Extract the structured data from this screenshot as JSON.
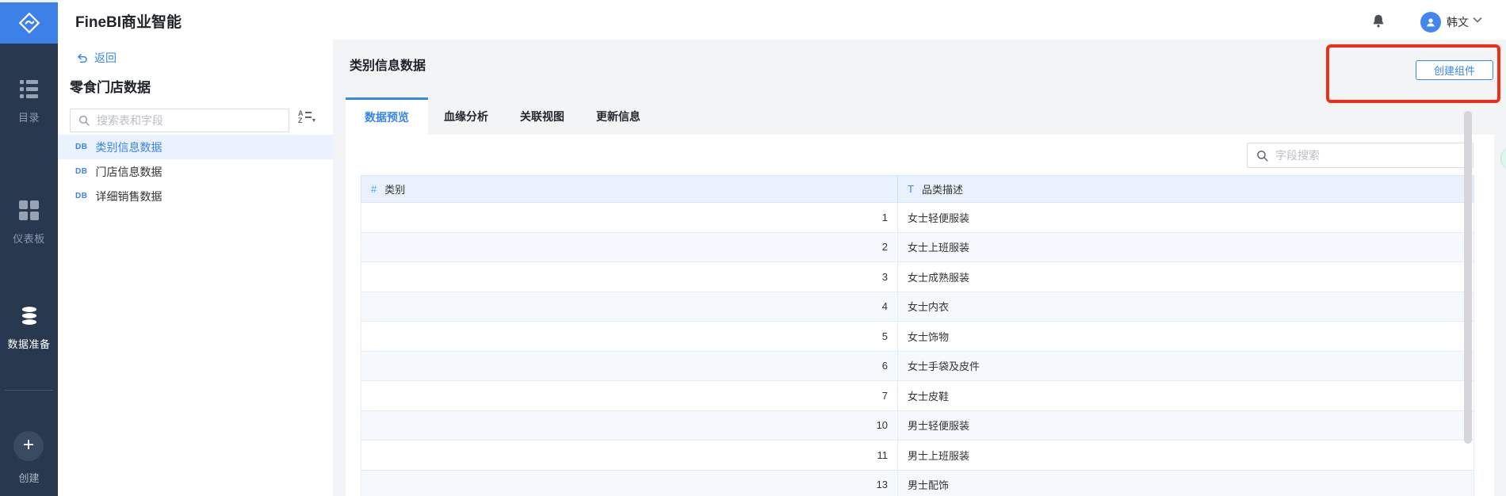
{
  "app": {
    "title": "FineBI商业智能"
  },
  "header": {
    "user_name": "韩文"
  },
  "sidebar": {
    "items": [
      {
        "key": "catalog",
        "icon": "list",
        "label": "目录",
        "active": false
      },
      {
        "key": "dashboard",
        "icon": "dashboard-grid",
        "label": "仪表板",
        "active": false
      },
      {
        "key": "data-preparation",
        "icon": "database",
        "label": "数据准备",
        "active": true
      }
    ],
    "create_label": "创建"
  },
  "panel": {
    "back_label": "返回",
    "title": "零食门店数据",
    "search_placeholder": "搜索表和字段",
    "db_badge": "DB",
    "tables": [
      {
        "label": "类别信息数据",
        "selected": true
      },
      {
        "label": "门店信息数据",
        "selected": false
      },
      {
        "label": "详细销售数据",
        "selected": false
      }
    ]
  },
  "main": {
    "title": "类别信息数据",
    "create_button_label": "创建组件",
    "tabs": [
      {
        "key": "data-preview",
        "label": "数据预览",
        "active": true
      },
      {
        "key": "lineage-analysis",
        "label": "血缘分析",
        "active": false
      },
      {
        "key": "relation-view",
        "label": "关联视图",
        "active": false
      },
      {
        "key": "update-info",
        "label": "更新信息",
        "active": false
      }
    ],
    "field_search_placeholder": "字段搜索",
    "table": {
      "columns": [
        {
          "type_glyph": "#",
          "type": "number",
          "label": "类别"
        },
        {
          "type_glyph": "T",
          "type": "text",
          "label": "品类描述"
        }
      ],
      "rows": [
        {
          "category": "1",
          "description": "女士轻便服装"
        },
        {
          "category": "2",
          "description": "女士上班服装"
        },
        {
          "category": "3",
          "description": "女士成熟服装"
        },
        {
          "category": "4",
          "description": "女士内衣"
        },
        {
          "category": "5",
          "description": "女士饰物"
        },
        {
          "category": "6",
          "description": "女士手袋及皮件"
        },
        {
          "category": "7",
          "description": "女士皮鞋"
        },
        {
          "category": "10",
          "description": "男士轻便服装"
        },
        {
          "category": "11",
          "description": "男士上班服装"
        },
        {
          "category": "13",
          "description": "男士配饰"
        }
      ]
    }
  },
  "colors": {
    "accent": "#3685f2",
    "logo_blue": "#3d80e8",
    "highlight_red": "#ee2e1b",
    "selected_bg": "#e9f2fd",
    "table_header_bg": "#e8f1fc",
    "row_alt_bg": "#f5f9fd",
    "sidebar_bg": "#28394f"
  }
}
